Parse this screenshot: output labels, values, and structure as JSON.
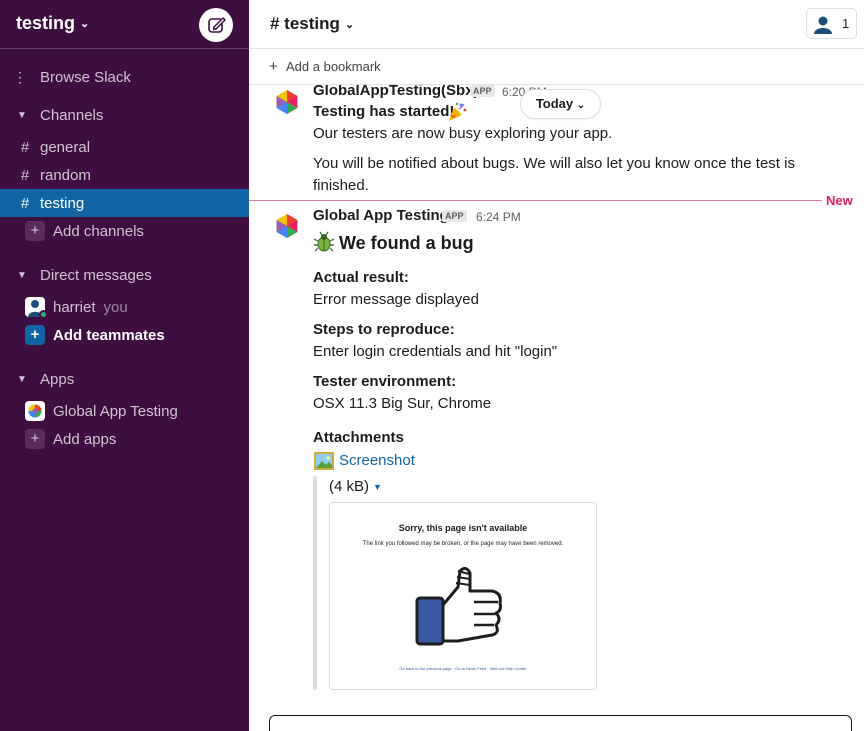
{
  "workspace": {
    "name": "testing"
  },
  "sidebar": {
    "browse": "Browse Slack",
    "channels_label": "Channels",
    "channels": [
      {
        "prefix": "#",
        "name": "general"
      },
      {
        "prefix": "#",
        "name": "random"
      },
      {
        "prefix": "#",
        "name": "testing"
      }
    ],
    "add_channels": "Add channels",
    "dm_label": "Direct messages",
    "dm_user": "harriet",
    "dm_you": "you",
    "add_teammates": "Add teammates",
    "apps_label": "Apps",
    "app_name": "Global App Testing",
    "add_apps": "Add apps"
  },
  "header": {
    "channel": "# testing",
    "member_count": "1"
  },
  "bookmark": {
    "plus": "+",
    "label": "Add a bookmark"
  },
  "today_pill": "Today",
  "messages": {
    "m1": {
      "sender": "GlobalAppTesting(Sbx)",
      "badge": "APP",
      "time": "6:20 PM",
      "title": "Testing has started!",
      "line1": "Our testers are now busy exploring your app.",
      "line2a": "You will be notified about bugs. We will also let you know once the test is",
      "line2b": "finished."
    },
    "new_label": "New",
    "m2": {
      "sender": "Global App Testing",
      "badge": "APP",
      "time": "6:24 PM",
      "title": "We found a bug",
      "actual_label": "Actual result:",
      "actual_value": "Error message displayed",
      "steps_label": "Steps to reproduce:",
      "steps_value": "Enter login credentials and hit \"login\"",
      "env_label": "Tester environment:",
      "env_value": "OSX 11.3 Big Sur, Chrome",
      "attachments_label": "Attachments",
      "attachment_name": "Screenshot",
      "attachment_size": "(4 kB)"
    }
  },
  "preview": {
    "heading": "Sorry, this page isn't available",
    "subtext": "The link you followed may be broken, or the page may have been removed.",
    "links": "Go back to the previous page · Go to News Feed · Visit our Help Center"
  },
  "colors": {
    "sidebar_bg": "#3f0e40",
    "active": "#1164a3",
    "new_marker": "#e01e5a",
    "link": "#1264a3"
  }
}
